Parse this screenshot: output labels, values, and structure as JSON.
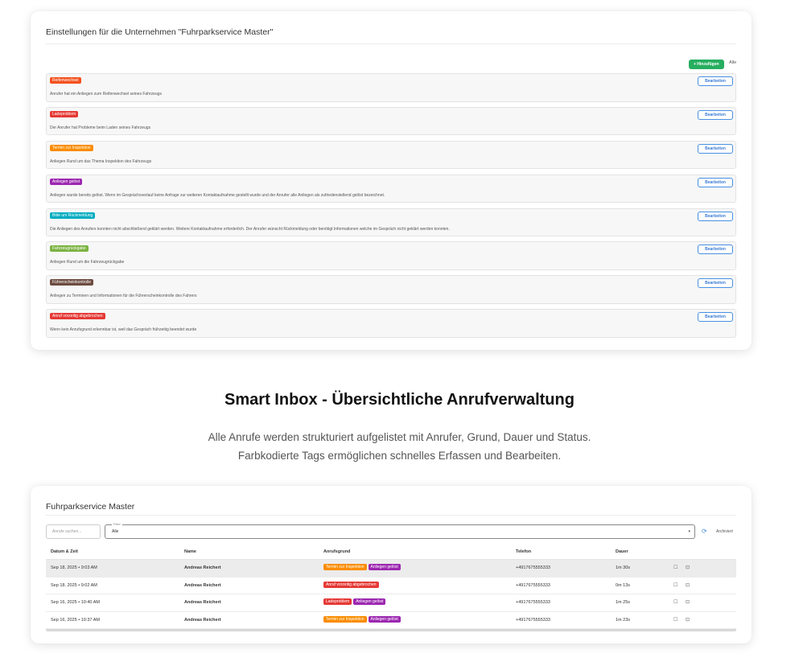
{
  "settings": {
    "title": "Einstellungen für die Unternehmen \"Fuhrparkservice Master\"",
    "add_button": "+ Hinzufügen",
    "all_link": "Alle",
    "edit_label": "Bearbeiten",
    "reasons": [
      {
        "tag": "Reifenwechsel",
        "color": "#f4511e",
        "desc": "Anrufer hat ein Anliegen zum Reifenwechsel seines Fahrzeugs"
      },
      {
        "tag": "Ladeproblem",
        "color": "#e53935",
        "desc": "Der Anrufer hat Probleme beim Laden seines Fahrzeugs"
      },
      {
        "tag": "Termin zur Inspektion",
        "color": "#fb8c00",
        "desc": "Anliegen Rund um das Thema Inspektion des Fahrzeugs"
      },
      {
        "tag": "Anliegen gelöst",
        "color": "#9c27b0",
        "desc": "Anliegen wurde bereits gelöst. Wenn im Gesprächsverlauf keine Anfrage zur weiteren Kontaktaufnahme gestellt wurde und der Anrufer alle Anliegen als zufriedenstellend gelöst bezeichnet."
      },
      {
        "tag": "Bitte um Rückmeldung",
        "color": "#00acc1",
        "desc": "Die Anliegen des Anrufers konnten nicht abschließend geklärt werden. Weitere Kontaktaufnahme erforderlich. Der Anrufer wünscht Rückmeldung oder benötigt Informationen welche im Gespräch nicht geklärt werden konnten."
      },
      {
        "tag": "Fahrzeugrückgabe",
        "color": "#7cb342",
        "desc": "Anliegen Rund um die Fahrzeugrückgabe"
      },
      {
        "tag": "Führerscheinkontrolle",
        "color": "#6d4c41",
        "desc": "Anliegen zu Terminen und Informationen für die Führerscheinkontrolle des Fahrers"
      },
      {
        "tag": "Anruf vorzeitig abgebrochen",
        "color": "#e53935",
        "desc": "Wenn kein Anrufsgrund erkennbar ist, weil das Gespräch frühzeitig beendet wurde"
      }
    ]
  },
  "heading": "Smart Inbox - Übersichtliche Anrufverwaltung",
  "subtitle_line1": "Alle Anrufe werden strukturiert aufgelistet mit Anrufer, Grund, Dauer und Status.",
  "subtitle_line2": "Farbkodierte Tags ermöglichen schnelles Erfassen und Bearbeiten.",
  "inbox": {
    "title": "Fuhrparkservice Master",
    "search_placeholder": "Anrufe suchen...",
    "filter_label": "Filter",
    "filter_value": "Alle",
    "archive_label": "Archiviert",
    "columns": [
      "Datum & Zeit",
      "Name",
      "Anrufsgrund",
      "Telefon",
      "Dauer"
    ],
    "rows": [
      {
        "date": "Sep 18, 2025 • 9:03 AM",
        "name": "Andreas Reichert",
        "tags": [
          {
            "label": "Termin zur Inspektion",
            "color": "#fb8c00"
          },
          {
            "label": "Anliegen gelöst",
            "color": "#9c27b0"
          }
        ],
        "phone": "+4917675555333",
        "duration": "1m 30s",
        "highlight": true
      },
      {
        "date": "Sep 18, 2025 • 9:02 AM",
        "name": "Andreas Reichert",
        "tags": [
          {
            "label": "Anruf vorzeitig abgebrochen",
            "color": "#e53935"
          }
        ],
        "phone": "+4917675555333",
        "duration": "0m 13s",
        "highlight": false
      },
      {
        "date": "Sep 16, 2025 • 10:40 AM",
        "name": "Andreas Reichert",
        "tags": [
          {
            "label": "Ladeproblem",
            "color": "#e53935"
          },
          {
            "label": "Anliegen gelöst",
            "color": "#9c27b0"
          }
        ],
        "phone": "+4917675555333",
        "duration": "1m 25s",
        "highlight": false
      },
      {
        "date": "Sep 16, 2025 • 10:37 AM",
        "name": "Andreas Reichert",
        "tags": [
          {
            "label": "Termin zur Inspektion",
            "color": "#fb8c00"
          },
          {
            "label": "Anliegen gelöst",
            "color": "#9c27b0"
          }
        ],
        "phone": "+4917675555333",
        "duration": "1m 23s",
        "highlight": false
      }
    ]
  }
}
